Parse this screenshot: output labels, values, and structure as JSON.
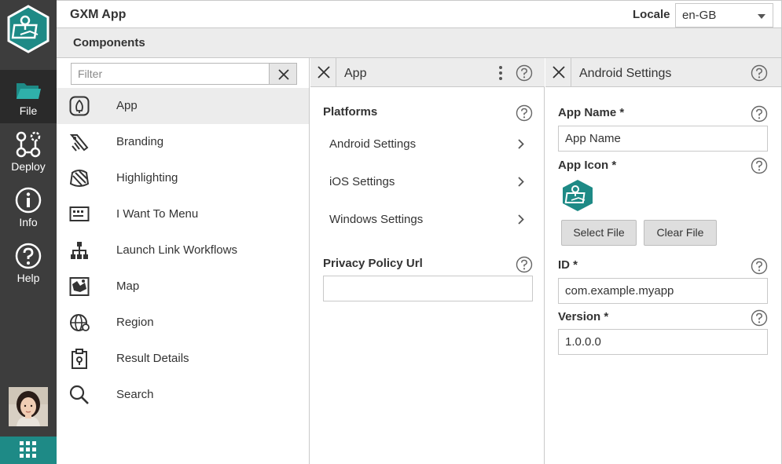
{
  "header": {
    "app_title": "GXM App",
    "locale_label": "Locale",
    "locale_value": "en-GB"
  },
  "rail": {
    "items": [
      {
        "label": "File",
        "icon": "folder-icon"
      },
      {
        "label": "Deploy",
        "icon": "deploy-icon"
      },
      {
        "label": "Info",
        "icon": "info-icon"
      },
      {
        "label": "Help",
        "icon": "help-icon"
      }
    ]
  },
  "components": {
    "title": "Components",
    "filter_placeholder": "Filter",
    "items": [
      {
        "label": "App",
        "icon": "app-icon"
      },
      {
        "label": "Branding",
        "icon": "branding-icon"
      },
      {
        "label": "Highlighting",
        "icon": "highlighting-icon"
      },
      {
        "label": "I Want To Menu",
        "icon": "menu-icon"
      },
      {
        "label": "Launch Link Workflows",
        "icon": "workflow-icon"
      },
      {
        "label": "Map",
        "icon": "map-icon"
      },
      {
        "label": "Region",
        "icon": "region-icon"
      },
      {
        "label": "Result Details",
        "icon": "result-details-icon"
      },
      {
        "label": "Search",
        "icon": "search-icon"
      }
    ]
  },
  "app_panel": {
    "title": "App",
    "platforms_label": "Platforms",
    "platforms": [
      {
        "label": "Android Settings"
      },
      {
        "label": "iOS Settings"
      },
      {
        "label": "Windows Settings"
      }
    ],
    "privacy_label": "Privacy Policy Url",
    "privacy_value": ""
  },
  "android_panel": {
    "title": "Android Settings",
    "app_name_label": "App Name *",
    "app_name_value": "App Name",
    "app_icon_label": "App Icon *",
    "select_file": "Select File",
    "clear_file": "Clear File",
    "id_label": "ID *",
    "id_value": "com.example.myapp",
    "version_label": "Version *",
    "version_value": "1.0.0.0"
  },
  "colors": {
    "accent": "#1e8a86",
    "rail": "#3d3d3d",
    "header_bg": "#ececec"
  }
}
